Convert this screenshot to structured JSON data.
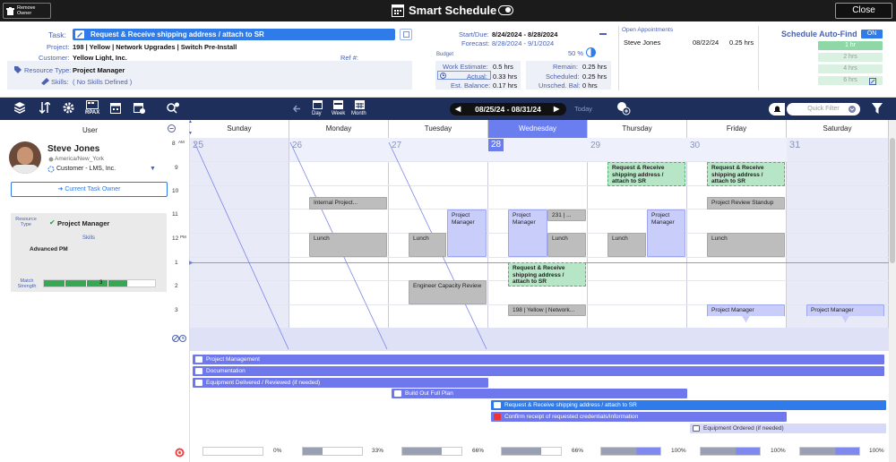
{
  "titlebar": {
    "remove_owner": "Remove Owner",
    "title": "Smart Schedule",
    "close": "Close"
  },
  "task": {
    "task_label": "Task:",
    "task_name": "Request & Receive shipping address / attach to SR",
    "project_label": "Project:",
    "project_value": "198 | Yellow | Network Upgrades  |  Switch Pre-Install",
    "customer_label": "Customer:",
    "customer_value": "Yellow Light, Inc.",
    "ref_label": "Ref #:",
    "resource_type_label": "Resource Type:",
    "resource_type_value": "Project Manager",
    "skills_label": "Skills:",
    "skills_value": "( No Skills Defined )"
  },
  "dates": {
    "start_due_label": "Start/Due:",
    "start_due_value": "8/24/2024  -  8/28/2024",
    "forecast_label": "Forecast:",
    "forecast_value": "8/28/2024  -  9/1/2024",
    "budget_label": "Budget",
    "budget_pct": "50 %"
  },
  "budget": {
    "work_estimate_label": "Work Estimate:",
    "work_estimate_value": "0.5 hrs",
    "actual_label": "Actual:",
    "actual_value": "0.33 hrs",
    "est_balance_label": "Est. Balance:",
    "est_balance_value": "0.17 hrs",
    "remain_label": "Remain:",
    "remain_value": "0.25 hrs",
    "scheduled_label": "Scheduled:",
    "scheduled_value": "0.25 hrs",
    "unsched_label": "Unsched. Bal:",
    "unsched_value": "0 hrs"
  },
  "open_appointments": {
    "title": "Open Appointments",
    "rows": [
      {
        "name": "Steve Jones",
        "date": "08/22/24",
        "hours": "0.25 hrs"
      }
    ]
  },
  "auto_find": {
    "title": "Schedule Auto-Find",
    "toggle": "ON",
    "options": [
      "1 hr",
      "2 hrs",
      "4 hrs",
      "6 hrs"
    ]
  },
  "toolbar": {
    "rpax": "RPAX",
    "day": "Day",
    "week": "Week",
    "month": "Month",
    "date_range": "08/25/24 - 08/31/24",
    "today": "Today",
    "quick_filter_placeholder": "Quick Filter"
  },
  "user_panel": {
    "header": "User",
    "name": "Steve Jones",
    "timezone": "America/New_York",
    "org": "Customer - LMS, Inc.",
    "current_owner_btn": "Current Task Owner",
    "resource_type_label": "Resource Type",
    "resource_type_value": "Project Manager",
    "skills_label": "Skills",
    "skills_value": "Advanced PM",
    "match_label": "Match Strength",
    "match_value": "3",
    "match_level": 0.75
  },
  "calendar": {
    "days": [
      "Sunday",
      "Monday",
      "Tuesday",
      "Wednesday",
      "Thursday",
      "Friday",
      "Saturday"
    ],
    "day_numbers": [
      "25",
      "26",
      "27",
      "28",
      "29",
      "30",
      "31"
    ],
    "hours": [
      "8",
      "9",
      "10",
      "11",
      "12",
      "1",
      "2",
      "3"
    ],
    "am": "AM",
    "pm": "PM",
    "events": {
      "mon_internal": "Internal Project...",
      "mon_lunch": "Lunch",
      "tue_pm": "Project Manager",
      "tue_lunch": "Lunch",
      "tue_ecr": "Engineer Capacity Review",
      "wed_pm": "Project Manager",
      "wed_231": "231 | ...",
      "wed_lunch": "Lunch",
      "wed_req": "Request & Receive shipping address / attach to SR",
      "wed_198": "198 | Yellow | Network...",
      "thu_req": "Request & Receive shipping address / attach to SR",
      "thu_lunch": "Lunch",
      "thu_pm": "Project Manager",
      "fri_req": "Request & Receive shipping address / attach to SR",
      "fri_standup": "Project Review Standup",
      "fri_lunch": "Lunch",
      "fri_pm": "Project Manager",
      "sat_pm": "Project Manager"
    }
  },
  "gantt": [
    "Project Management",
    "Documentation",
    "Equipment Delivered / Reviewed (if needed)",
    "Build Out Full Plan",
    "Request & Receive shipping address / attach to SR",
    "Confirm receipt of requested credentials/information",
    "Equipment Ordered (if needed)"
  ],
  "utilization": [
    {
      "label": "0%",
      "level": 0
    },
    {
      "label": "33%",
      "level": 0.33
    },
    {
      "label": "66%",
      "level": 0.66
    },
    {
      "label": "66%",
      "level": 0.66
    },
    {
      "label": "100%",
      "level": 1
    },
    {
      "label": "100%",
      "level": 1
    },
    {
      "label": "100%",
      "level": 1
    }
  ],
  "colors": {
    "accent": "#2e7be9",
    "toolbar": "#1f2f5c",
    "gantt_bar": "#6e78ec",
    "selected_day": "#6b7ef0",
    "green": "#48b26e"
  }
}
